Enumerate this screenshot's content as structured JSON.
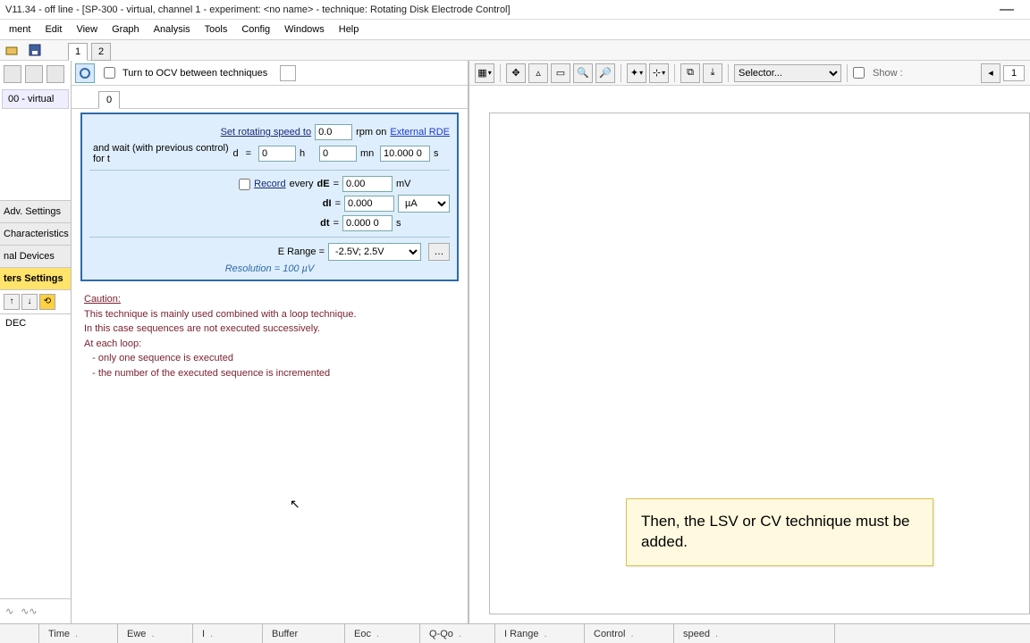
{
  "titlebar": {
    "text": "V11.34 - off line - [SP-300 - virtual, channel 1 - experiment: <no name> - technique: Rotating Disk Electrode Control]"
  },
  "menu": [
    "ment",
    "Edit",
    "View",
    "Graph",
    "Analysis",
    "Tools",
    "Config",
    "Windows",
    "Help"
  ],
  "toolrow": {
    "tab1": "1",
    "tab2": "2"
  },
  "left": {
    "virtual": "00 - virtual",
    "tabs": [
      "Adv. Settings",
      "Characteristics",
      "nal Devices",
      "ters Settings"
    ],
    "tech": "DEC"
  },
  "center": {
    "ocv_label": "Turn to OCV between techniques",
    "seq_tab": "0"
  },
  "params": {
    "set_speed": "Set rotating speed to",
    "speed_val": "0.0",
    "rpm_on": "rpm on",
    "ext_rde": "External RDE",
    "wait_label": "and wait (with previous control)  for  t",
    "wait_sub": "d",
    "wait_eq": "=",
    "h_val": "0",
    "h_unit": "h",
    "mn_val": "0",
    "mn_unit": "mn",
    "s_val": "10.000 0",
    "s_unit": "s",
    "record_label": "Record",
    "every_label": "every",
    "dE": "dE",
    "dE_eq": "=",
    "dE_val": "0.00",
    "dE_unit": "mV",
    "dI": "dI",
    "dI_eq": "=",
    "dI_val": "0.000",
    "dI_unit": "µA",
    "dt": "dt",
    "dt_eq": "=",
    "dt_val": "0.000 0",
    "dt_unit": "s",
    "erange_label": "E Range  =",
    "erange_val": "-2.5V; 2.5V",
    "resolution": "Resolution = 100 µV"
  },
  "caution": {
    "hd": "Caution:",
    "l1": "This technique is mainly used combined with a loop technique.",
    "l2": "In this case sequences are not executed successively.",
    "l3": "At each loop:",
    "l4": "   - only one sequence is executed",
    "l5": "   - the number of the executed sequence is incremented"
  },
  "graph": {
    "selector": "Selector...",
    "show": "Show :",
    "pg": "1"
  },
  "callout": "Then, the LSV or CV technique must be added.",
  "status": {
    "cells": [
      "Time",
      "Ewe",
      "I",
      "Buffer",
      "Eoc",
      "Q-Qo",
      "I Range",
      "Control",
      "speed"
    ],
    "dots": [
      ".",
      ".",
      ".",
      "",
      ".",
      ".",
      ".",
      ".",
      "."
    ]
  }
}
